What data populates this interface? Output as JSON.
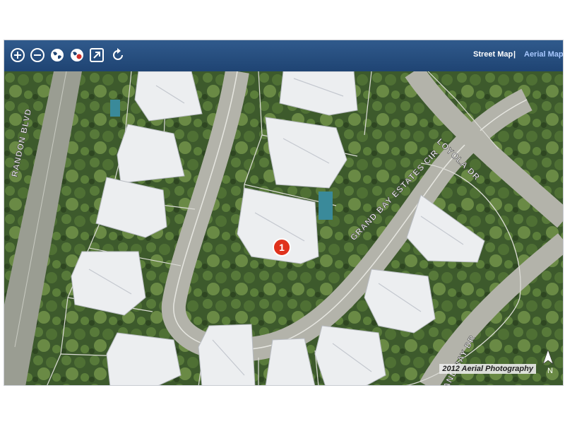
{
  "toolbar": {
    "tools": [
      {
        "name": "zoom-in",
        "icon": "zoom-in-icon"
      },
      {
        "name": "zoom-out",
        "icon": "zoom-out-icon"
      },
      {
        "name": "globe",
        "icon": "globe-icon"
      },
      {
        "name": "globe-pin",
        "icon": "globe-pin-icon"
      },
      {
        "name": "open-external",
        "icon": "open-external-icon"
      },
      {
        "name": "refresh",
        "icon": "refresh-icon"
      }
    ],
    "map_types": {
      "street_map_label": "Street Map",
      "separator": "|",
      "aerial_map_label": "Aerial Map",
      "active": "Aerial Map",
      "active_color": "#a8c8ff"
    }
  },
  "map": {
    "streets": [
      {
        "label": "RANDON BLVD"
      },
      {
        "label": "GRAND BAY ESTATES CIR"
      },
      {
        "label": "LOYOLA DR"
      },
      {
        "label": "GRAND BAY DR",
        "shown": "AND BAY DR"
      }
    ],
    "marker": {
      "label": "1",
      "color": "#e0321c"
    },
    "credit": "2012 Aerial Photography",
    "north_label": "N"
  }
}
